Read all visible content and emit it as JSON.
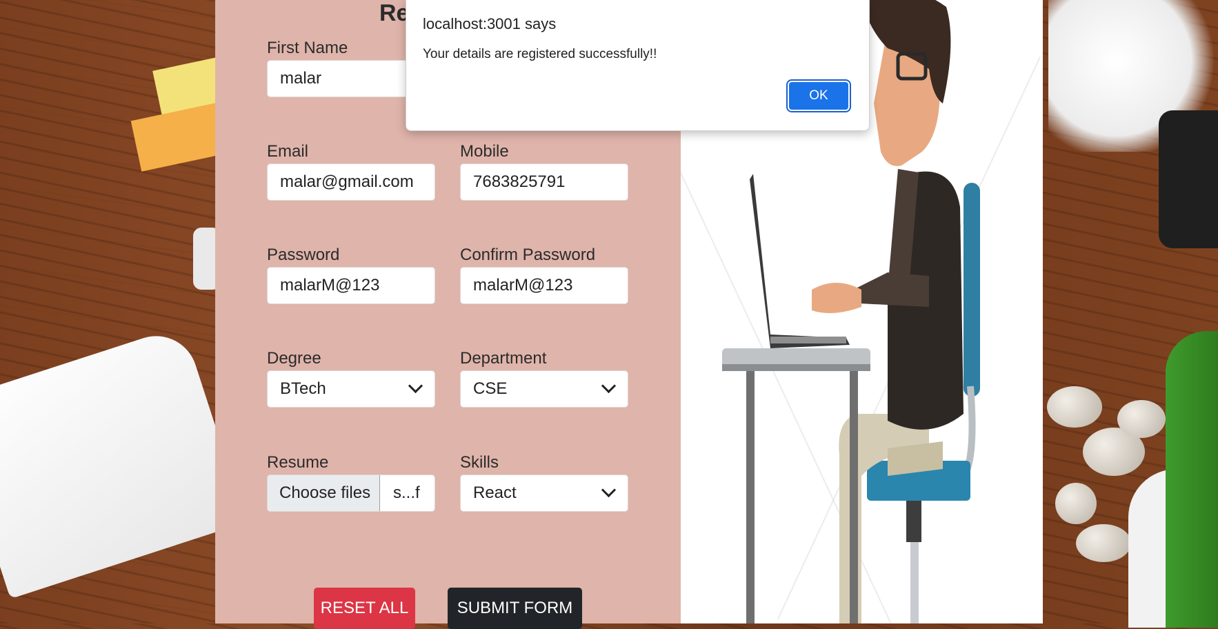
{
  "form": {
    "title": "Re",
    "fields": {
      "first_name": {
        "label": "First Name",
        "value": "malar"
      },
      "email": {
        "label": "Email",
        "value": "malar@gmail.com"
      },
      "mobile": {
        "label": "Mobile",
        "value": "7683825791"
      },
      "password": {
        "label": "Password",
        "value": "malarM@123"
      },
      "confirm_password": {
        "label": "Confirm Password",
        "value": "malarM@123"
      },
      "degree": {
        "label": "Degree",
        "value": "BTech"
      },
      "department": {
        "label": "Department",
        "value": "CSE"
      },
      "resume": {
        "label": "Resume",
        "button": "Choose files",
        "file_name": "s...f"
      },
      "skills": {
        "label": "Skills",
        "value": "React"
      }
    },
    "buttons": {
      "reset": "RESET ALL",
      "submit": "SUBMIT FORM"
    }
  },
  "alert": {
    "title": "localhost:3001 says",
    "message": "Your details are registered successfully!!",
    "ok_label": "OK"
  },
  "colors": {
    "form_panel_bg": "#dfb4aa",
    "reset_button": "#dc3545",
    "submit_button": "#212529",
    "ok_button": "#1a73e8"
  }
}
